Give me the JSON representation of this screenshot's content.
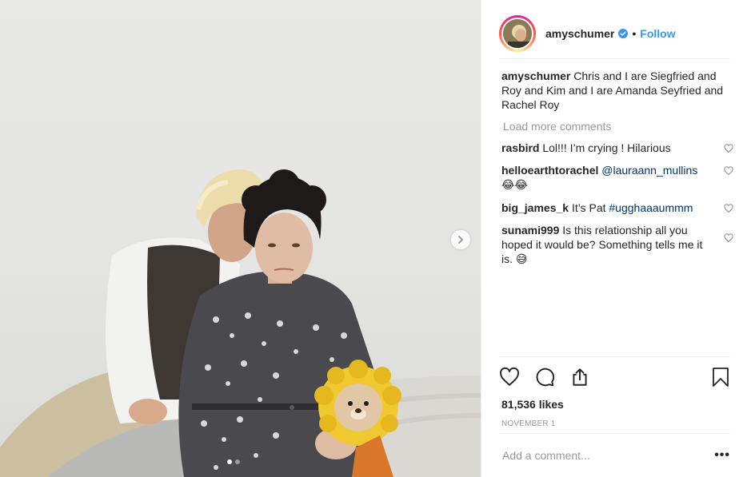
{
  "post": {
    "username": "amyschumer",
    "follow_label": "Follow",
    "bullet": "•",
    "caption_user": "amyschumer",
    "caption_text": "Chris and I are Siegfried and Roy and Kim and I are Amanda Seyfried and Rachel Roy",
    "load_more": "Load more comments",
    "comments": [
      {
        "user": "rasbird",
        "text": "Lol!!! I’m crying ! Hilarious"
      },
      {
        "user": "helloearthtorachel",
        "mention": "@lauraann_mullins",
        "emoji": "😂😂"
      },
      {
        "user": "big_james_k",
        "text": "It’s Pat",
        "hashtag": "#ugghaaaummm"
      },
      {
        "user": "sunami999",
        "text": "Is this relationship all you hoped it would be? Something tells me it is.",
        "emoji": "😅"
      }
    ],
    "likes": "81,536 likes",
    "date": "NOVEMBER 1",
    "add_comment_placeholder": "Add a comment...",
    "more_label": "•••"
  },
  "icons": {
    "verified": "verified-badge-icon",
    "like": "heart-icon",
    "comment": "comment-bubble-icon",
    "share": "share-upload-icon",
    "save": "bookmark-icon",
    "next": "chevron-right-icon"
  },
  "colors": {
    "link": "#3897f0",
    "mention": "#003569",
    "muted": "#999999",
    "text": "#262626"
  }
}
